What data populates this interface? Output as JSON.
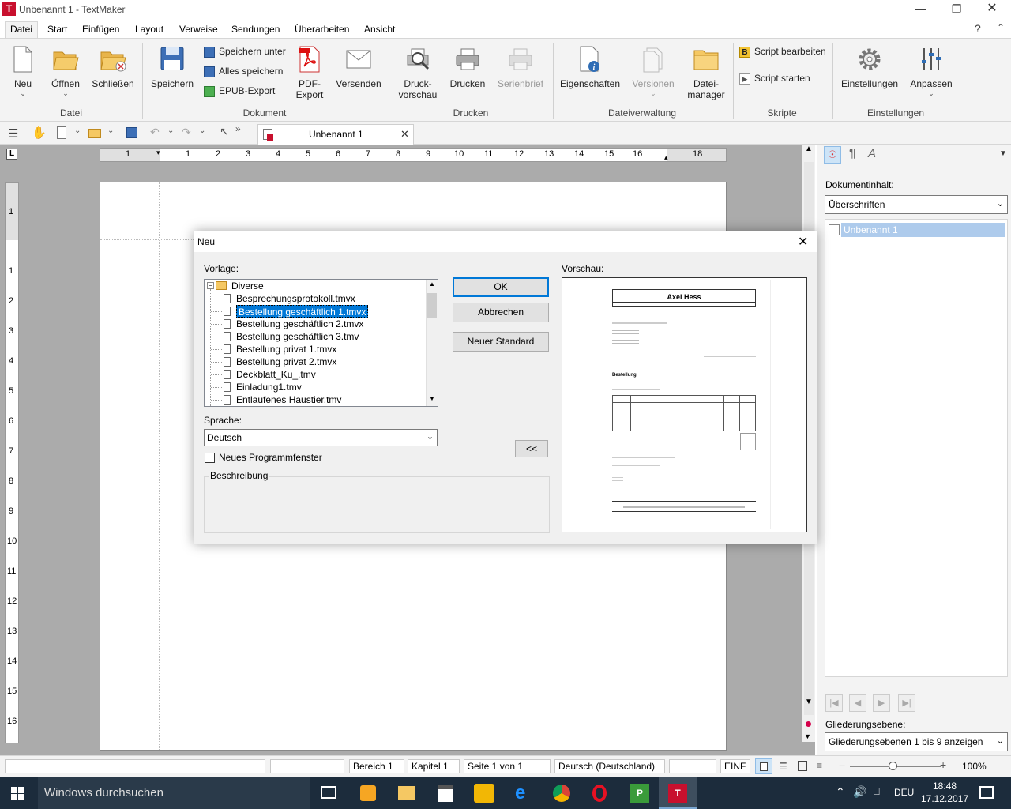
{
  "window": {
    "title": "Unbenannt 1 - TextMaker"
  },
  "menu": [
    "Datei",
    "Start",
    "Einfügen",
    "Layout",
    "Verweise",
    "Sendungen",
    "Überarbeiten",
    "Ansicht"
  ],
  "ribbon": {
    "neu": "Neu",
    "oeffnen": "Öffnen",
    "schliessen": "Schließen",
    "speichern": "Speichern",
    "speichern_unter": "Speichern unter",
    "alles_speichern": "Alles speichern",
    "epub": "EPUB-Export",
    "pdf1": "PDF-",
    "pdf2": "Export",
    "versenden": "Versenden",
    "druck1": "Druck-",
    "druck2": "vorschau",
    "drucken": "Drucken",
    "serienbrief": "Serienbrief",
    "eigenschaften": "Eigenschaften",
    "versionen": "Versionen",
    "datei1": "Datei-",
    "datei2": "manager",
    "script_bearbeiten": "Script bearbeiten",
    "script_starten": "Script starten",
    "einstellungen": "Einstellungen",
    "anpassen": "Anpassen",
    "groups": {
      "datei": "Datei",
      "dokument": "Dokument",
      "drucken": "Drucken",
      "dateiverwaltung": "Dateiverwaltung",
      "skripte": "Skripte",
      "einstellungen": "Einstellungen"
    }
  },
  "tab": {
    "label": "Unbenannt 1"
  },
  "ruler": {
    "h": [
      "1",
      "1",
      "2",
      "3",
      "4",
      "5",
      "6",
      "7",
      "8",
      "9",
      "10",
      "11",
      "12",
      "13",
      "14",
      "15",
      "16",
      "18"
    ],
    "v": [
      "1",
      "1",
      "2",
      "3",
      "4",
      "5",
      "6",
      "7",
      "8",
      "9",
      "10",
      "11",
      "12",
      "13",
      "14",
      "15",
      "16"
    ]
  },
  "sidebar": {
    "content_label": "Dokumentinhalt:",
    "content_value": "Überschriften",
    "tree_item": "Unbenannt 1",
    "outline_label": "Gliederungsebene:",
    "outline_value": "Gliederungsebenen 1 bis 9 anzeigen"
  },
  "status": {
    "bereich": "Bereich 1",
    "kapitel": "Kapitel 1",
    "seite": "Seite 1 von 1",
    "sprache": "Deutsch (Deutschland)",
    "mode": "EINF",
    "zoom": "100%",
    "minus": "−",
    "plus": "+"
  },
  "taskbar": {
    "search": "Windows durchsuchen",
    "lang": "DEU",
    "time": "18:48",
    "date": "17.12.2017"
  },
  "dialog": {
    "title": "Neu",
    "vorlage_label": "Vorlage:",
    "vorschau_label": "Vorschau:",
    "folder": "Diverse",
    "templates": [
      "Besprechungsprotokoll.tmvx",
      "Bestellung geschäftlich 1.tmvx",
      "Bestellung geschäftlich 2.tmvx",
      "Bestellung geschäftlich 3.tmv",
      "Bestellung privat 1.tmvx",
      "Bestellung privat 2.tmvx",
      "Deckblatt_Ku_.tmv",
      "Einladung1.tmv",
      "Entlaufenes Haustier.tmv"
    ],
    "selected_index": 1,
    "ok": "OK",
    "abbrechen": "Abbrechen",
    "neuer_standard": "Neuer Standard",
    "sprache_label": "Sprache:",
    "sprache_value": "Deutsch",
    "neues_fenster": "Neues Programmfenster",
    "beschreibung": "Beschreibung",
    "collapse": "<<",
    "preview": {
      "name": "Axel Hess",
      "heading": "Bestellung"
    }
  }
}
